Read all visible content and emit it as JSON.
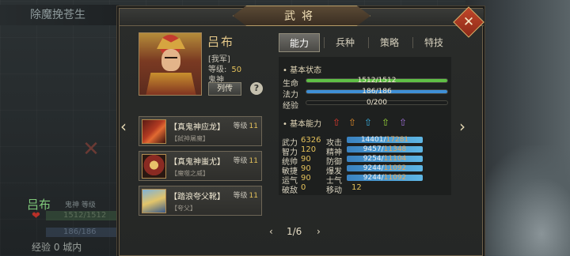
{
  "scene": {
    "title": "除魔挽苍生",
    "left_name": "吕布",
    "left_sub": "鬼神 等级",
    "left_hp": "1512/1512",
    "left_mp": "186/186",
    "left_xp": "经验 0 城内"
  },
  "window": {
    "title": "武将",
    "close_icon": "close-icon"
  },
  "general": {
    "name": "吕布",
    "faction": "[我军]",
    "level_label": "等级:",
    "level_value": "50",
    "title": "鬼神",
    "bio_button": "列传",
    "help_button": "?"
  },
  "equipment": [
    {
      "name": "【真鬼神应龙】",
      "level_label": "等级",
      "level": "11",
      "desc": "【弑神屠魔】",
      "icon": "halberd-icon"
    },
    {
      "name": "【真鬼神蚩尤】",
      "level_label": "等级",
      "level": "11",
      "desc": "【魔噬之威】",
      "icon": "armor-icon"
    },
    {
      "name": "【踏浪夸父靴】",
      "level_label": "等级",
      "level": "11",
      "desc": "【夸父】",
      "icon": "boots-icon"
    }
  ],
  "tabs": [
    "能力",
    "兵种",
    "策略",
    "特技"
  ],
  "basic_status": {
    "header": "基本状态",
    "rows": [
      {
        "label": "生命",
        "text": "1512/1512",
        "fraction": 1.0,
        "color": "#5fbf46"
      },
      {
        "label": "法力",
        "text": "186/186",
        "fraction": 1.0,
        "color": "#3f8fd6"
      },
      {
        "label": "经验",
        "text": "0/200",
        "fraction": 0.0,
        "color": "#c9b04a"
      }
    ]
  },
  "basic_ability": {
    "header": "基本能力",
    "gems": [
      {
        "glyph": "⇧",
        "color": "#e03a2e",
        "icon": "red-up-arrow-icon"
      },
      {
        "glyph": "⇧",
        "color": "#e08a2a",
        "icon": "orange-up-arrow-icon"
      },
      {
        "glyph": "⇧",
        "color": "#3ab0e0",
        "icon": "cyan-up-arrow-icon"
      },
      {
        "glyph": "⇧",
        "color": "#9ad83a",
        "icon": "green-up-arrow-icon"
      },
      {
        "glyph": "⇧",
        "color": "#a070d8",
        "icon": "purple-up-arrow-icon"
      }
    ],
    "attrs": [
      {
        "label": "武力",
        "value": "6326"
      },
      {
        "label": "智力",
        "value": "120"
      },
      {
        "label": "统帅",
        "value": "90"
      },
      {
        "label": "敏捷",
        "value": "90"
      },
      {
        "label": "运气",
        "value": "90"
      },
      {
        "label": "破敌",
        "value": "0"
      }
    ],
    "combat": [
      {
        "label": "攻击",
        "current": "14401",
        "max": "17281"
      },
      {
        "label": "精神",
        "current": "9457",
        "max": "11348"
      },
      {
        "label": "防御",
        "current": "9254",
        "max": "11104"
      },
      {
        "label": "爆发",
        "current": "9244",
        "max": "11092"
      },
      {
        "label": "士气",
        "current": "9244",
        "max": "11092"
      }
    ],
    "move_label": "移动",
    "move_value": "12"
  },
  "pager": {
    "text": "1/6",
    "prev": "‹",
    "next": "›"
  },
  "nav": {
    "prev": "‹",
    "next": "›"
  }
}
